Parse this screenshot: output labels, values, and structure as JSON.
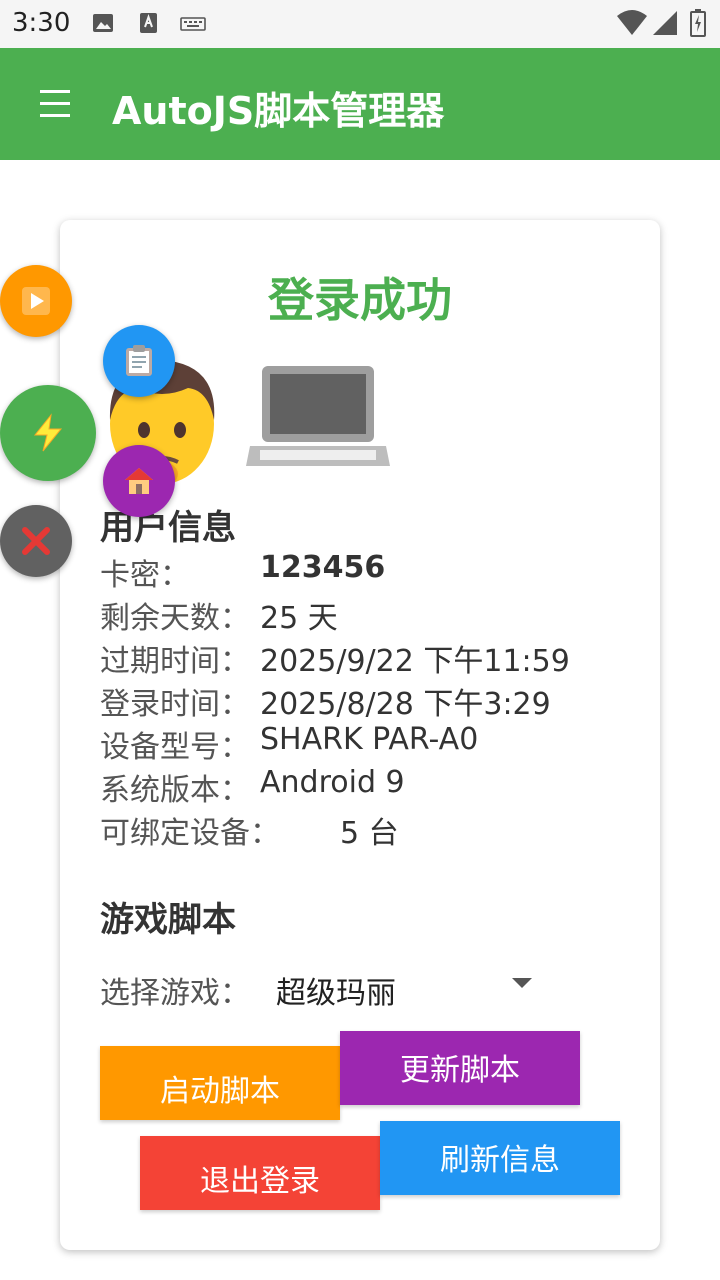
{
  "status_bar": {
    "time": "3:30"
  },
  "app_bar": {
    "title": "AutoJS脚本管理器"
  },
  "card": {
    "success_title": "登录成功",
    "user_section": "用户信息",
    "user_rows": [
      {
        "label": "卡密：",
        "value": "123456"
      },
      {
        "label": "剩余天数：",
        "value": "25 天"
      },
      {
        "label": "过期时间：",
        "value": "2025/9/22 下午11:59"
      },
      {
        "label": "登录时间：",
        "value": "2025/8/28 下午3:29"
      },
      {
        "label": "设备型号：",
        "value": "SHARK PAR-A0"
      },
      {
        "label": "系统版本：",
        "value": "Android 9"
      },
      {
        "label": "可绑定设备：",
        "value": "5 台"
      }
    ],
    "script_section": "游戏脚本",
    "select_label": "选择游戏：",
    "select_value": "超级玛丽",
    "buttons": {
      "start": "启动脚本",
      "update": "更新脚本",
      "logout": "退出登录",
      "refresh": "刷新信息"
    }
  },
  "colors": {
    "primary": "#4caf50",
    "orange": "#ff9800",
    "purple": "#9c27b0",
    "red": "#f44336",
    "blue": "#2196f3",
    "gray": "#616161"
  }
}
